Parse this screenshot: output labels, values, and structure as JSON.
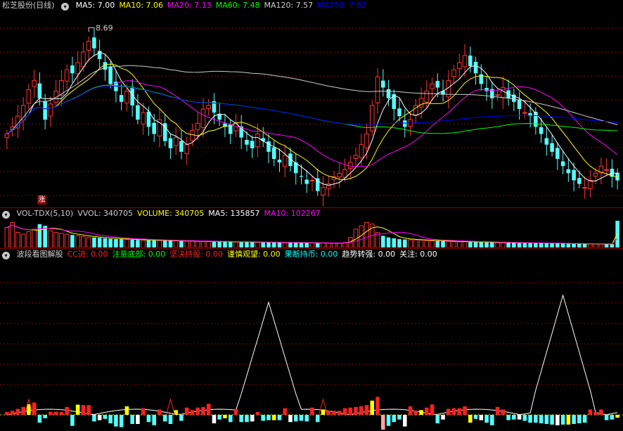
{
  "header": {
    "title": "松芝股份(日线)",
    "ma_items": [
      {
        "label": "MA5: 7.00",
        "color": "#ffffff"
      },
      {
        "label": "MA10: 7.06",
        "color": "#ffff00"
      },
      {
        "label": "MA20: 7.13",
        "color": "#ff00ff"
      },
      {
        "label": "MA60: 7.48",
        "color": "#00ff00"
      },
      {
        "label": "MA120: 7.57",
        "color": "#cccccc"
      },
      {
        "label": "MA250: 7.82",
        "color": "#0000ff"
      }
    ]
  },
  "volume_header": {
    "items": [
      {
        "label": "VOL-TDX(5,10)",
        "color": "#cccccc"
      },
      {
        "label": "VVOL: 340705",
        "color": "#cccccc"
      },
      {
        "label": "VOLUME: 340705",
        "color": "#ffff00"
      },
      {
        "label": "MA5: 135857",
        "color": "#ffffff"
      },
      {
        "label": "MA10: 102267",
        "color": "#ff00ff"
      }
    ]
  },
  "indicator_header": {
    "items": [
      {
        "label": "波段看图解股",
        "color": "#cccccc"
      },
      {
        "label": "CC进: 0.00",
        "color": "#ff2020"
      },
      {
        "label": "注意底部: 0.00",
        "color": "#00ff00"
      },
      {
        "label": "坚决持股: 0.00",
        "color": "#ff2020"
      },
      {
        "label": "谨慎观望: 0.00",
        "color": "#ffff00"
      },
      {
        "label": "果断持币: 0.00",
        "color": "#00ffff"
      },
      {
        "label": "趋势转强: 0.00",
        "color": "#ffffff"
      },
      {
        "label": "关注: 0.00",
        "color": "#ffffff"
      }
    ]
  },
  "annotations": {
    "high_label": "8.69",
    "zhang_tag": "涨"
  },
  "colors": {
    "up": "#ff3232",
    "down": "#54ffff",
    "grid": "#8b0000",
    "ma5": "#ffffff",
    "ma10": "#ffff00",
    "ma20": "#ff00ff",
    "ma60": "#00ff00",
    "ma120": "#cccccc",
    "ma250": "#0000ff"
  },
  "chart_data": [
    {
      "type": "candlestick",
      "title": "松芝股份(日线)",
      "price_range": [
        6.2,
        8.9
      ],
      "high_marker": 8.69,
      "close": [
        7.2,
        7.3,
        7.45,
        7.6,
        7.82,
        7.95,
        7.7,
        7.4,
        7.62,
        7.8,
        7.95,
        8.1,
        8.05,
        8.2,
        8.35,
        8.5,
        8.4,
        8.25,
        8.1,
        7.9,
        7.8,
        7.65,
        7.8,
        7.6,
        7.4,
        7.5,
        7.3,
        7.2,
        7.4,
        7.1,
        7.0,
        7.15,
        6.95,
        7.05,
        7.25,
        7.35,
        7.55,
        7.6,
        7.5,
        7.4,
        7.3,
        7.2,
        7.35,
        7.15,
        7.05,
        7.0,
        7.2,
        7.1,
        6.95,
        6.85,
        6.8,
        6.9,
        6.75,
        6.65,
        6.6,
        6.5,
        6.55,
        6.4,
        6.45,
        6.5,
        6.6,
        6.65,
        6.7,
        6.8,
        6.9,
        7.05,
        7.2,
        7.6,
        8.0,
        7.85,
        7.7,
        7.55,
        7.45,
        7.3,
        7.4,
        7.6,
        7.7,
        7.8,
        7.9,
        7.85,
        7.75,
        7.95,
        8.1,
        8.2,
        8.3,
        8.15,
        8.05,
        7.9,
        7.8,
        7.7,
        7.75,
        7.85,
        7.7,
        7.65,
        7.55,
        7.5,
        7.45,
        7.3,
        7.2,
        7.05,
        6.95,
        6.85,
        6.75,
        6.65,
        6.55,
        6.5,
        6.45,
        6.55,
        6.65,
        6.75,
        6.7,
        6.6,
        6.55
      ],
      "ma_values": {
        "MA5": 7.0,
        "MA10": 7.06,
        "MA20": 7.13,
        "MA60": 7.48,
        "MA120": 7.57,
        "MA250": 7.82
      }
    },
    {
      "type": "bar",
      "title": "VOL-TDX(5,10)",
      "values": [
        120000,
        150000,
        90000,
        80000,
        95000,
        110000,
        140000,
        130000,
        100000,
        90000,
        85000,
        80000,
        75000,
        70000,
        65000,
        60000,
        60000,
        58000,
        55000,
        52000,
        50000,
        50000,
        48000,
        46000,
        45000,
        44000,
        43000,
        42000,
        42000,
        41000,
        40000,
        40000,
        39000,
        38000,
        38000,
        37000,
        36000,
        36000,
        35000,
        35000,
        34000,
        34000,
        33000,
        33000,
        32000,
        32000,
        31000,
        31000,
        30000,
        30000,
        30000,
        29000,
        29000,
        28000,
        28000,
        28000,
        27000,
        27000,
        27000,
        26000,
        26000,
        26000,
        30000,
        60000,
        110000,
        130000,
        150000,
        140000,
        90000,
        70000,
        60000,
        55000,
        50000,
        48000,
        46000,
        45000,
        44000,
        42000,
        40000,
        39000,
        38000,
        37000,
        36000,
        35000,
        34000,
        33000,
        32000,
        31000,
        30000,
        30000,
        29000,
        29000,
        28000,
        28000,
        27000,
        27000,
        26000,
        26000,
        25000,
        25000,
        24000,
        24000,
        23000,
        23000,
        22000,
        22000,
        22000,
        21000,
        21000,
        20000,
        20000,
        20000,
        340705
      ],
      "ma_values": {
        "VVOL": 340705,
        "VOLUME": 340705,
        "MA5": 135857,
        "MA10": 102267
      }
    },
    {
      "type": "line",
      "title": "波段看图解股",
      "series_values": {
        "CC进": 0.0,
        "注意底部": 0.0,
        "坚决持股": 0.0,
        "谨慎观望": 0.0,
        "果断持币": 0.0,
        "趋势转强": 0.0,
        "关注": 0.0
      }
    }
  ]
}
